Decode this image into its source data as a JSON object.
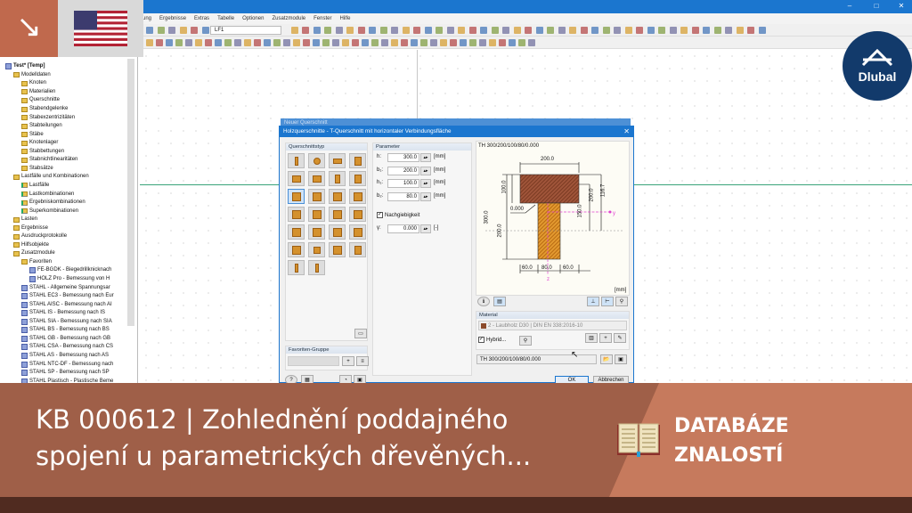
{
  "menu": [
    "ung",
    "Ergebnisse",
    "Extras",
    "Tabelle",
    "Optionen",
    "Zusatzmodule",
    "Fenster",
    "Hilfe"
  ],
  "toolbar": {
    "loadcase": "LF1"
  },
  "logo": {
    "text": "Dlubal"
  },
  "tree": [
    {
      "label": "Test* [Temp]",
      "level": 0,
      "type": "root"
    },
    {
      "label": "Modelldaten",
      "level": 1,
      "type": "folder"
    },
    {
      "label": "Knoten",
      "level": 2,
      "type": "folder"
    },
    {
      "label": "Materialien",
      "level": 2,
      "type": "folder"
    },
    {
      "label": "Querschnitte",
      "level": 2,
      "type": "folder"
    },
    {
      "label": "Stabendgelenke",
      "level": 2,
      "type": "folder"
    },
    {
      "label": "Stabexzentrizitäten",
      "level": 2,
      "type": "folder"
    },
    {
      "label": "Stabteilungen",
      "level": 2,
      "type": "folder"
    },
    {
      "label": "Stäbe",
      "level": 2,
      "type": "folder"
    },
    {
      "label": "Knotenlager",
      "level": 2,
      "type": "folder"
    },
    {
      "label": "Stabbettungen",
      "level": 2,
      "type": "folder"
    },
    {
      "label": "Stabnichtlinearitäten",
      "level": 2,
      "type": "folder"
    },
    {
      "label": "Stabsätze",
      "level": 2,
      "type": "folder"
    },
    {
      "label": "Lastfälle und Kombinationen",
      "level": 1,
      "type": "folder"
    },
    {
      "label": "Lastfälle",
      "level": 2,
      "type": "item"
    },
    {
      "label": "Lastkombinationen",
      "level": 2,
      "type": "item"
    },
    {
      "label": "Ergebniskombinationen",
      "level": 2,
      "type": "item"
    },
    {
      "label": "Superkombinationen",
      "level": 2,
      "type": "item"
    },
    {
      "label": "Lasten",
      "level": 1,
      "type": "folder"
    },
    {
      "label": "Ergebnisse",
      "level": 1,
      "type": "folder"
    },
    {
      "label": "Ausdruckprotokolle",
      "level": 1,
      "type": "folder"
    },
    {
      "label": "Hilfsobjekte",
      "level": 1,
      "type": "folder"
    },
    {
      "label": "Zusatzmodule",
      "level": 1,
      "type": "folder"
    },
    {
      "label": "Favoriten",
      "level": 2,
      "type": "folder"
    },
    {
      "label": "FE-BGDK - Biegedrillknicknach",
      "level": 3,
      "type": "module"
    },
    {
      "label": "HOLZ Pro - Bemessung von H",
      "level": 3,
      "type": "module"
    },
    {
      "label": "STAHL - Allgemeine Spannungsar",
      "level": 2,
      "type": "module"
    },
    {
      "label": "STAHL EC3 - Bemessung nach Eur",
      "level": 2,
      "type": "module"
    },
    {
      "label": "STAHL AISC - Bemessung nach AI",
      "level": 2,
      "type": "module"
    },
    {
      "label": "STAHL IS - Bemessung nach IS",
      "level": 2,
      "type": "module"
    },
    {
      "label": "STAHL SIA - Bemessung nach SIA",
      "level": 2,
      "type": "module"
    },
    {
      "label": "STAHL BS - Bemessung nach BS",
      "level": 2,
      "type": "module"
    },
    {
      "label": "STAHL GB - Bemessung nach GB",
      "level": 2,
      "type": "module"
    },
    {
      "label": "STAHL CSA - Bemessung nach CS",
      "level": 2,
      "type": "module"
    },
    {
      "label": "STAHL AS - Bemessung nach AS",
      "level": 2,
      "type": "module"
    },
    {
      "label": "STAHL NTC-DF - Bemessung nach",
      "level": 2,
      "type": "module"
    },
    {
      "label": "STAHL SP - Bemessung nach SP",
      "level": 2,
      "type": "module"
    },
    {
      "label": "STAHL Plastisch - Plastische Beme",
      "level": 2,
      "type": "module"
    }
  ],
  "dialog": {
    "back_title": "Neuer Querschnitt",
    "title": "Holzquerschnitte - T-Querschnitt mit horizontaler Verbindungsfläche",
    "type_group": "Querschnittstyp",
    "fav_group": "Favoriten-Gruppe",
    "param_group": "Parameter",
    "params": [
      {
        "label": "h:",
        "value": "300.0",
        "unit": "[mm]"
      },
      {
        "label": "b₁:",
        "value": "200.0",
        "unit": "[mm]"
      },
      {
        "label": "h₁:",
        "value": "100.0",
        "unit": "[mm]"
      },
      {
        "label": "b₂:",
        "value": "80.0",
        "unit": "[mm]"
      }
    ],
    "flex_label": "Nachgiebigkeit",
    "flex_checked": true,
    "gamma": {
      "label": "γ:",
      "value": "0.000",
      "unit": "[-]"
    },
    "preview_title": "TH 300/200/100/80/0.000",
    "dims": {
      "top": "200.0",
      "flange": "100.0",
      "total": "300.0",
      "web": "200.0",
      "gap": "0.000",
      "d150": "150.0",
      "d200": "200.0",
      "d1167": "116.7",
      "b1": "60.0",
      "b2": "80.0",
      "b3": "60.0",
      "y": "y",
      "z": "z",
      "unit": "[mm]"
    },
    "material_group": "Material",
    "material": "2 - Laubholz D30 | DIN EN 338:2016-10",
    "material_color": "#8b4a2b",
    "hybrid_label": "Hybrid...",
    "hybrid_checked": true,
    "name_value": "TH 300/200/100/80/0.000",
    "ok": "OK",
    "cancel": "Abbrechen"
  },
  "banner": {
    "title_line1": "KB 000612 | Zohlednění poddajného",
    "title_line2": "spojení u parametrických dřevěných...",
    "category_line1": "DATABÁZE",
    "category_line2": "ZNALOSTÍ"
  }
}
